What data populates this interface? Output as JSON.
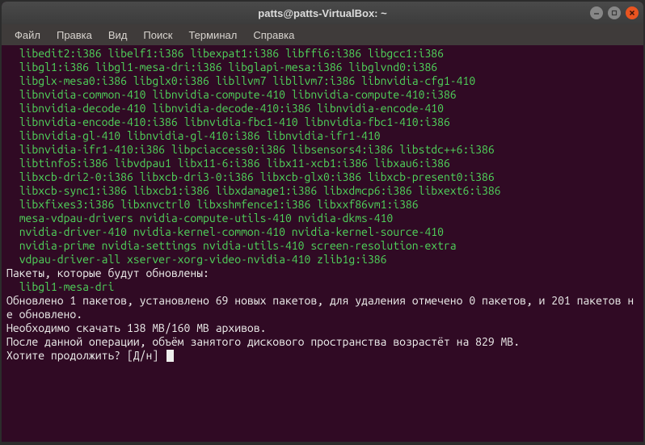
{
  "window": {
    "title": "patts@patts-VirtualBox: ~"
  },
  "menu": {
    "file": "Файл",
    "edit": "Правка",
    "view": "Вид",
    "search": "Поиск",
    "terminal": "Терминал",
    "help": "Справка"
  },
  "term": {
    "pkg_lines": [
      "  libedit2:i386 libelf1:i386 libexpat1:i386 libffi6:i386 libgcc1:i386",
      "  libgl1:i386 libgl1-mesa-dri:i386 libglapi-mesa:i386 libglvnd0:i386",
      "  libglx-mesa0:i386 libglx0:i386 libllvm7 libllvm7:i386 libnvidia-cfg1-410",
      "  libnvidia-common-410 libnvidia-compute-410 libnvidia-compute-410:i386",
      "  libnvidia-decode-410 libnvidia-decode-410:i386 libnvidia-encode-410",
      "  libnvidia-encode-410:i386 libnvidia-fbc1-410 libnvidia-fbc1-410:i386",
      "  libnvidia-gl-410 libnvidia-gl-410:i386 libnvidia-ifr1-410",
      "  libnvidia-ifr1-410:i386 libpciaccess0:i386 libsensors4:i386 libstdc++6:i386",
      "  libtinfo5:i386 libvdpau1 libx11-6:i386 libx11-xcb1:i386 libxau6:i386",
      "  libxcb-dri2-0:i386 libxcb-dri3-0:i386 libxcb-glx0:i386 libxcb-present0:i386",
      "  libxcb-sync1:i386 libxcb1:i386 libxdamage1:i386 libxdmcp6:i386 libxext6:i386",
      "  libxfixes3:i386 libxnvctrl0 libxshmfence1:i386 libxxf86vm1:i386",
      "  mesa-vdpau-drivers nvidia-compute-utils-410 nvidia-dkms-410",
      "  nvidia-driver-410 nvidia-kernel-common-410 nvidia-kernel-source-410",
      "  nvidia-prime nvidia-settings nvidia-utils-410 screen-resolution-extra",
      "  vdpau-driver-all xserver-xorg-video-nvidia-410 zlib1g:i386"
    ],
    "upgrade_header": "Пакеты, которые будут обновлены:",
    "upgrade_pkg": "  libgl1-mesa-dri",
    "summary1": "Обновлено 1 пакетов, установлено 69 новых пакетов, для удаления отмечено 0 пакетов, и 201 пакетов не обновлено.",
    "summary2": "Необходимо скачать 138 MB/160 MB архивов.",
    "summary3": "После данной операции, объём занятого дискового пространства возрастёт на 829 MB.",
    "prompt": "Хотите продолжить? [Д/н] "
  }
}
